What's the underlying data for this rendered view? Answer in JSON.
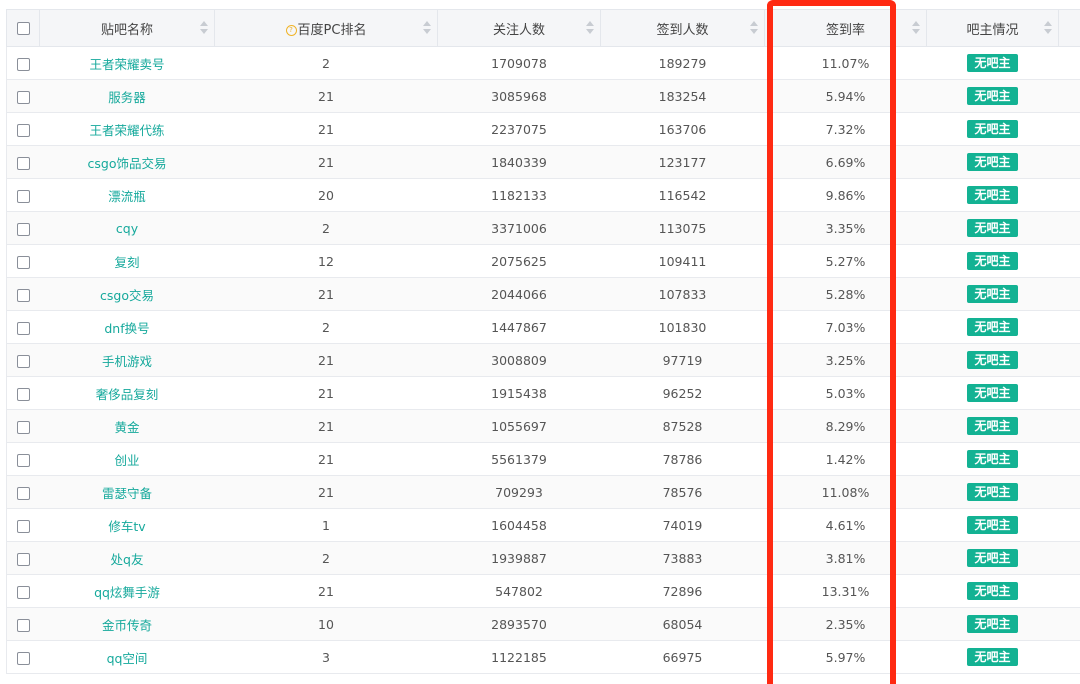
{
  "table": {
    "headers": {
      "name": "贴吧名称",
      "rank": "百度PC排名",
      "follow": "关注人数",
      "sign": "签到人数",
      "rate": "签到率",
      "status": "吧主情况"
    },
    "rows": [
      {
        "name": "王者荣耀卖号",
        "rank": "2",
        "follow": "1709078",
        "sign": "189279",
        "rate": "11.07%",
        "status": "无吧主"
      },
      {
        "name": "服务器",
        "rank": "21",
        "follow": "3085968",
        "sign": "183254",
        "rate": "5.94%",
        "status": "无吧主"
      },
      {
        "name": "王者荣耀代练",
        "rank": "21",
        "follow": "2237075",
        "sign": "163706",
        "rate": "7.32%",
        "status": "无吧主"
      },
      {
        "name": "csgo饰品交易",
        "rank": "21",
        "follow": "1840339",
        "sign": "123177",
        "rate": "6.69%",
        "status": "无吧主"
      },
      {
        "name": "漂流瓶",
        "rank": "20",
        "follow": "1182133",
        "sign": "116542",
        "rate": "9.86%",
        "status": "无吧主"
      },
      {
        "name": "cqy",
        "rank": "2",
        "follow": "3371006",
        "sign": "113075",
        "rate": "3.35%",
        "status": "无吧主"
      },
      {
        "name": "复刻",
        "rank": "12",
        "follow": "2075625",
        "sign": "109411",
        "rate": "5.27%",
        "status": "无吧主"
      },
      {
        "name": "csgo交易",
        "rank": "21",
        "follow": "2044066",
        "sign": "107833",
        "rate": "5.28%",
        "status": "无吧主"
      },
      {
        "name": "dnf换号",
        "rank": "2",
        "follow": "1447867",
        "sign": "101830",
        "rate": "7.03%",
        "status": "无吧主"
      },
      {
        "name": "手机游戏",
        "rank": "21",
        "follow": "3008809",
        "sign": "97719",
        "rate": "3.25%",
        "status": "无吧主"
      },
      {
        "name": "奢侈品复刻",
        "rank": "21",
        "follow": "1915438",
        "sign": "96252",
        "rate": "5.03%",
        "status": "无吧主"
      },
      {
        "name": "黄金",
        "rank": "21",
        "follow": "1055697",
        "sign": "87528",
        "rate": "8.29%",
        "status": "无吧主"
      },
      {
        "name": "创业",
        "rank": "21",
        "follow": "5561379",
        "sign": "78786",
        "rate": "1.42%",
        "status": "无吧主"
      },
      {
        "name": "雷瑟守备",
        "rank": "21",
        "follow": "709293",
        "sign": "78576",
        "rate": "11.08%",
        "status": "无吧主"
      },
      {
        "name": "修车tv",
        "rank": "1",
        "follow": "1604458",
        "sign": "74019",
        "rate": "4.61%",
        "status": "无吧主"
      },
      {
        "name": "处q友",
        "rank": "2",
        "follow": "1939887",
        "sign": "73883",
        "rate": "3.81%",
        "status": "无吧主"
      },
      {
        "name": "qq炫舞手游",
        "rank": "21",
        "follow": "547802",
        "sign": "72896",
        "rate": "13.31%",
        "status": "无吧主"
      },
      {
        "name": "金币传奇",
        "rank": "10",
        "follow": "2893570",
        "sign": "68054",
        "rate": "2.35%",
        "status": "无吧主"
      },
      {
        "name": "qq空间",
        "rank": "3",
        "follow": "1122185",
        "sign": "66975",
        "rate": "5.97%",
        "status": "无吧主"
      }
    ]
  },
  "colors": {
    "link": "#16a99c",
    "badge": "#13b293",
    "highlight": "#ff2a12"
  }
}
